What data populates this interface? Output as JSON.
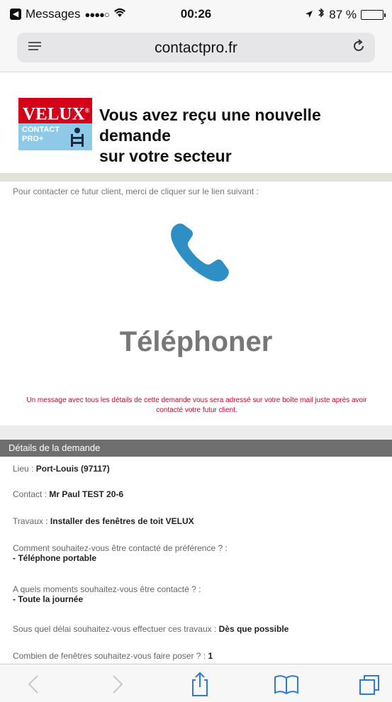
{
  "status_bar": {
    "back_app": "Messages",
    "signal": "●●●●○",
    "time": "00:26",
    "battery_text": "87 %",
    "battery_level": 0.87
  },
  "browser": {
    "url": "contactpro.fr"
  },
  "header": {
    "logo_text": "VELUX",
    "logo_sub_1": "CONTACT",
    "logo_sub_2": "PRO+",
    "title_line1": "Vous avez reçu une nouvelle demande",
    "title_line2": "sur votre secteur"
  },
  "intro": "Pour contacter ce futur client, merci de cliquer sur le lien suivant :",
  "call_label": "Téléphoner",
  "notice": "Un message avec tous les détails de cette demande vous sera adressé sur votre boîte mail juste après avoir contacté votre futur client.",
  "details": {
    "header": "Détails de la demande",
    "rows": [
      {
        "label": "Lieu : ",
        "value": "Port-Louis (97117)"
      },
      {
        "label": "Contact : ",
        "value": "Mr Paul TEST 20-6"
      },
      {
        "label": "Travaux : ",
        "value": "Installer des fenêtres de toit VELUX"
      },
      {
        "label": "Comment souhaitez-vous être contacté de préférence ? :",
        "value": "- Téléphone portable"
      },
      {
        "label": "A quels moments souhaitez-vous être contacté ? :",
        "value": "- Toute la journée"
      },
      {
        "label": "Sous quel délai souhaitez-vous effectuer ces travaux : ",
        "value": "Dès que possible"
      },
      {
        "label": "Combien de fenêtres souhaitez-vous faire poser ? : ",
        "value": "1"
      }
    ]
  },
  "colors": {
    "phone_icon": "#2e8fc4",
    "notice": "#d8002a",
    "velux_red": "#d4001a"
  }
}
